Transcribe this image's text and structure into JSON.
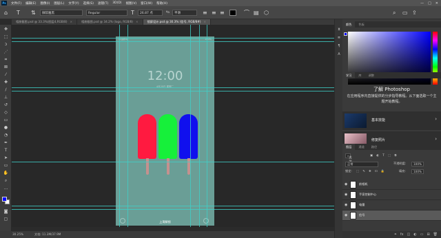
{
  "menubar": {
    "items": [
      "文件(F)",
      "编辑(E)",
      "图像(I)",
      "图层(L)",
      "文字(Y)",
      "选择(S)",
      "滤镜(T)",
      "3D(D)",
      "视图(V)",
      "窗口(W)",
      "帮助(H)"
    ],
    "window_buttons": [
      "—",
      "□",
      "✕"
    ]
  },
  "options": {
    "font_family": "微软雅黑",
    "font_style": "Regular",
    "font_size": "26.87 点",
    "antialias": "平滑",
    "aa_label": "ªa"
  },
  "tabs": [
    {
      "label": "相册截图.psd @ 33.3%(图层4,RGB/8)",
      "active": false
    },
    {
      "label": "相册截图.psd @ 34.2% (logo, RGB/8)",
      "active": false
    },
    {
      "label": "锁屏设计.psd @ 30.3% (信号, RGB/8#)",
      "active": true
    }
  ],
  "canvas": {
    "time": "12:00",
    "date_line": "4月25日 星期二",
    "status_left": "中国移动",
    "status_right": "100%",
    "bottom_label": "上滑解锁",
    "popsicle_colors": [
      "#ff1a40",
      "#16f03a",
      "#1010ee"
    ]
  },
  "status": {
    "zoom": "30.25%",
    "doc_info": "文档: 11.3M/37.9M"
  },
  "color_panel": {
    "tabs": [
      "颜色",
      "色板"
    ],
    "foreground": "#0000ff",
    "background": "#ffffff"
  },
  "learn_panel": {
    "tabs": [
      "学习",
      "库",
      "调整"
    ],
    "title": "了解 Photoshop",
    "description": "在应用程序内直接提供的分步指导教程。从下面选取一个主题开始教程。",
    "cards": [
      "基本技能",
      "修复照片"
    ]
  },
  "layers_panel": {
    "tabs": [
      "图层",
      "通道",
      "路径"
    ],
    "kind_label": "类型",
    "blend_mode": "正常",
    "opacity_label": "不透明度:",
    "opacity_value": "100%",
    "lock_label": "锁定:",
    "fill_label": "填充:",
    "fill_value": "100%",
    "layers": [
      {
        "name": "前相机",
        "selected": false
      },
      {
        "name": "手家控制中心",
        "selected": false
      },
      {
        "name": "电量",
        "selected": false
      },
      {
        "name": "信号",
        "selected": true
      }
    ]
  }
}
